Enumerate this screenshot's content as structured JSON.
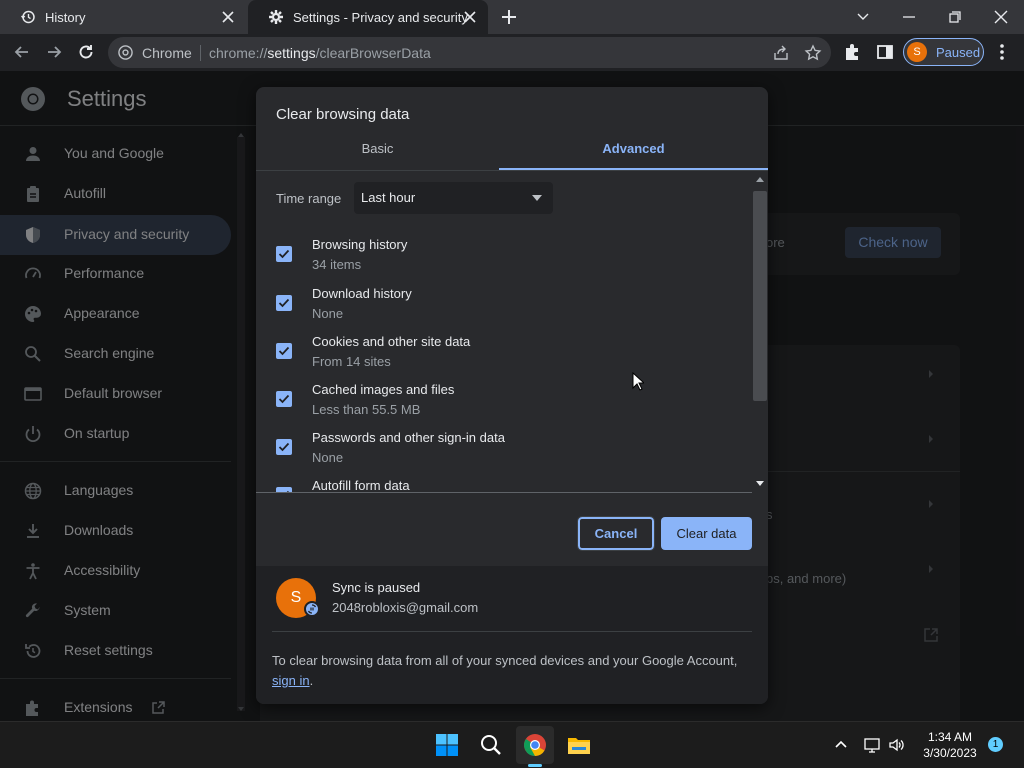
{
  "tabs": [
    {
      "title": "History",
      "icon": "history-icon"
    },
    {
      "title": "Settings - Privacy and security",
      "icon": "gear-icon"
    }
  ],
  "omnibox": {
    "site_chip": "Chrome",
    "url_prefix": "chrome://",
    "url_host": "settings",
    "url_path": "/clearBrowserData"
  },
  "profile": {
    "initial": "S",
    "status": "Paused"
  },
  "settings": {
    "title": "Settings",
    "sidebar": [
      {
        "label": "You and Google",
        "icon": "person-icon"
      },
      {
        "label": "Autofill",
        "icon": "clipboard-icon"
      },
      {
        "label": "Privacy and security",
        "icon": "shield-icon"
      },
      {
        "label": "Performance",
        "icon": "speedometer-icon"
      },
      {
        "label": "Appearance",
        "icon": "palette-icon"
      },
      {
        "label": "Search engine",
        "icon": "search-icon"
      },
      {
        "label": "Default browser",
        "icon": "browser-icon"
      },
      {
        "label": "On startup",
        "icon": "power-icon"
      },
      {
        "label": "Languages",
        "icon": "globe-icon"
      },
      {
        "label": "Downloads",
        "icon": "download-icon"
      },
      {
        "label": "Accessibility",
        "icon": "accessibility-icon"
      },
      {
        "label": "System",
        "icon": "wrench-icon"
      },
      {
        "label": "Reset settings",
        "icon": "reset-icon"
      },
      {
        "label": "Extensions",
        "icon": "puzzle-icon"
      }
    ],
    "background": {
      "check_now": "Check now",
      "partial_more": "ore",
      "partial_s": "s",
      "partial_and_more": "ps, and more)"
    }
  },
  "dialog": {
    "title": "Clear browsing data",
    "tab_basic": "Basic",
    "tab_advanced": "Advanced",
    "time_range_label": "Time range",
    "time_range_value": "Last hour",
    "options": [
      {
        "label": "Browsing history",
        "sub": "34 items",
        "checked": true
      },
      {
        "label": "Download history",
        "sub": "None",
        "checked": true
      },
      {
        "label": "Cookies and other site data",
        "sub": "From 14 sites",
        "checked": true
      },
      {
        "label": "Cached images and files",
        "sub": "Less than 55.5 MB",
        "checked": true
      },
      {
        "label": "Passwords and other sign-in data",
        "sub": "None",
        "checked": true
      },
      {
        "label": "Autofill form data",
        "sub": "",
        "checked": true
      }
    ],
    "cancel": "Cancel",
    "clear": "Clear data",
    "sync_status": "Sync is paused",
    "sync_email": "2048robloxis@gmail.com",
    "sync_initial": "S",
    "note_text": "To clear browsing data from all of your synced devices and your Google Account, ",
    "note_link": "sign in",
    "note_end": "."
  },
  "taskbar": {
    "time": "1:34 AM",
    "date": "3/30/2023",
    "notifications": "1"
  },
  "colors": {
    "accent": "#8ab4f8",
    "background": "#202124",
    "dialog": "#292a2d",
    "avatar": "#e8710a"
  }
}
